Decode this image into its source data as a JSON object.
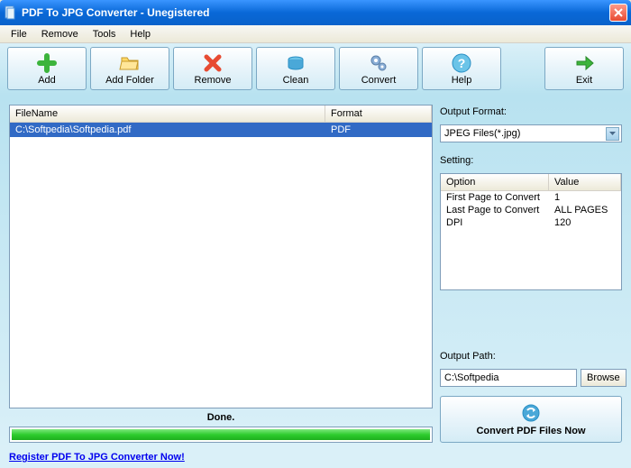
{
  "window": {
    "title": "PDF To JPG Converter - Unegistered"
  },
  "menu": {
    "file": "File",
    "remove": "Remove",
    "tools": "Tools",
    "help": "Help"
  },
  "toolbar": {
    "add": "Add",
    "addFolder": "Add Folder",
    "remove": "Remove",
    "clean": "Clean",
    "convert": "Convert",
    "help": "Help",
    "exit": "Exit"
  },
  "fileList": {
    "headers": {
      "filename": "FileName",
      "format": "Format"
    },
    "rows": [
      {
        "filename": "C:\\Softpedia\\Softpedia.pdf",
        "format": "PDF"
      }
    ]
  },
  "status": "Done.",
  "outputFormat": {
    "label": "Output Format:",
    "value": "JPEG Files(*.jpg)"
  },
  "settings": {
    "label": "Setting:",
    "headers": {
      "option": "Option",
      "value": "Value"
    },
    "rows": [
      {
        "option": "First Page to Convert",
        "value": "1"
      },
      {
        "option": "Last Page to Convert",
        "value": "ALL PAGES"
      },
      {
        "option": "DPI",
        "value": "120"
      }
    ]
  },
  "outputPath": {
    "label": "Output Path:",
    "value": "C:\\Softpedia",
    "browse": "Browse"
  },
  "convertNow": "Convert PDF Files Now",
  "registerLink": "Register PDF To JPG Converter Now!"
}
